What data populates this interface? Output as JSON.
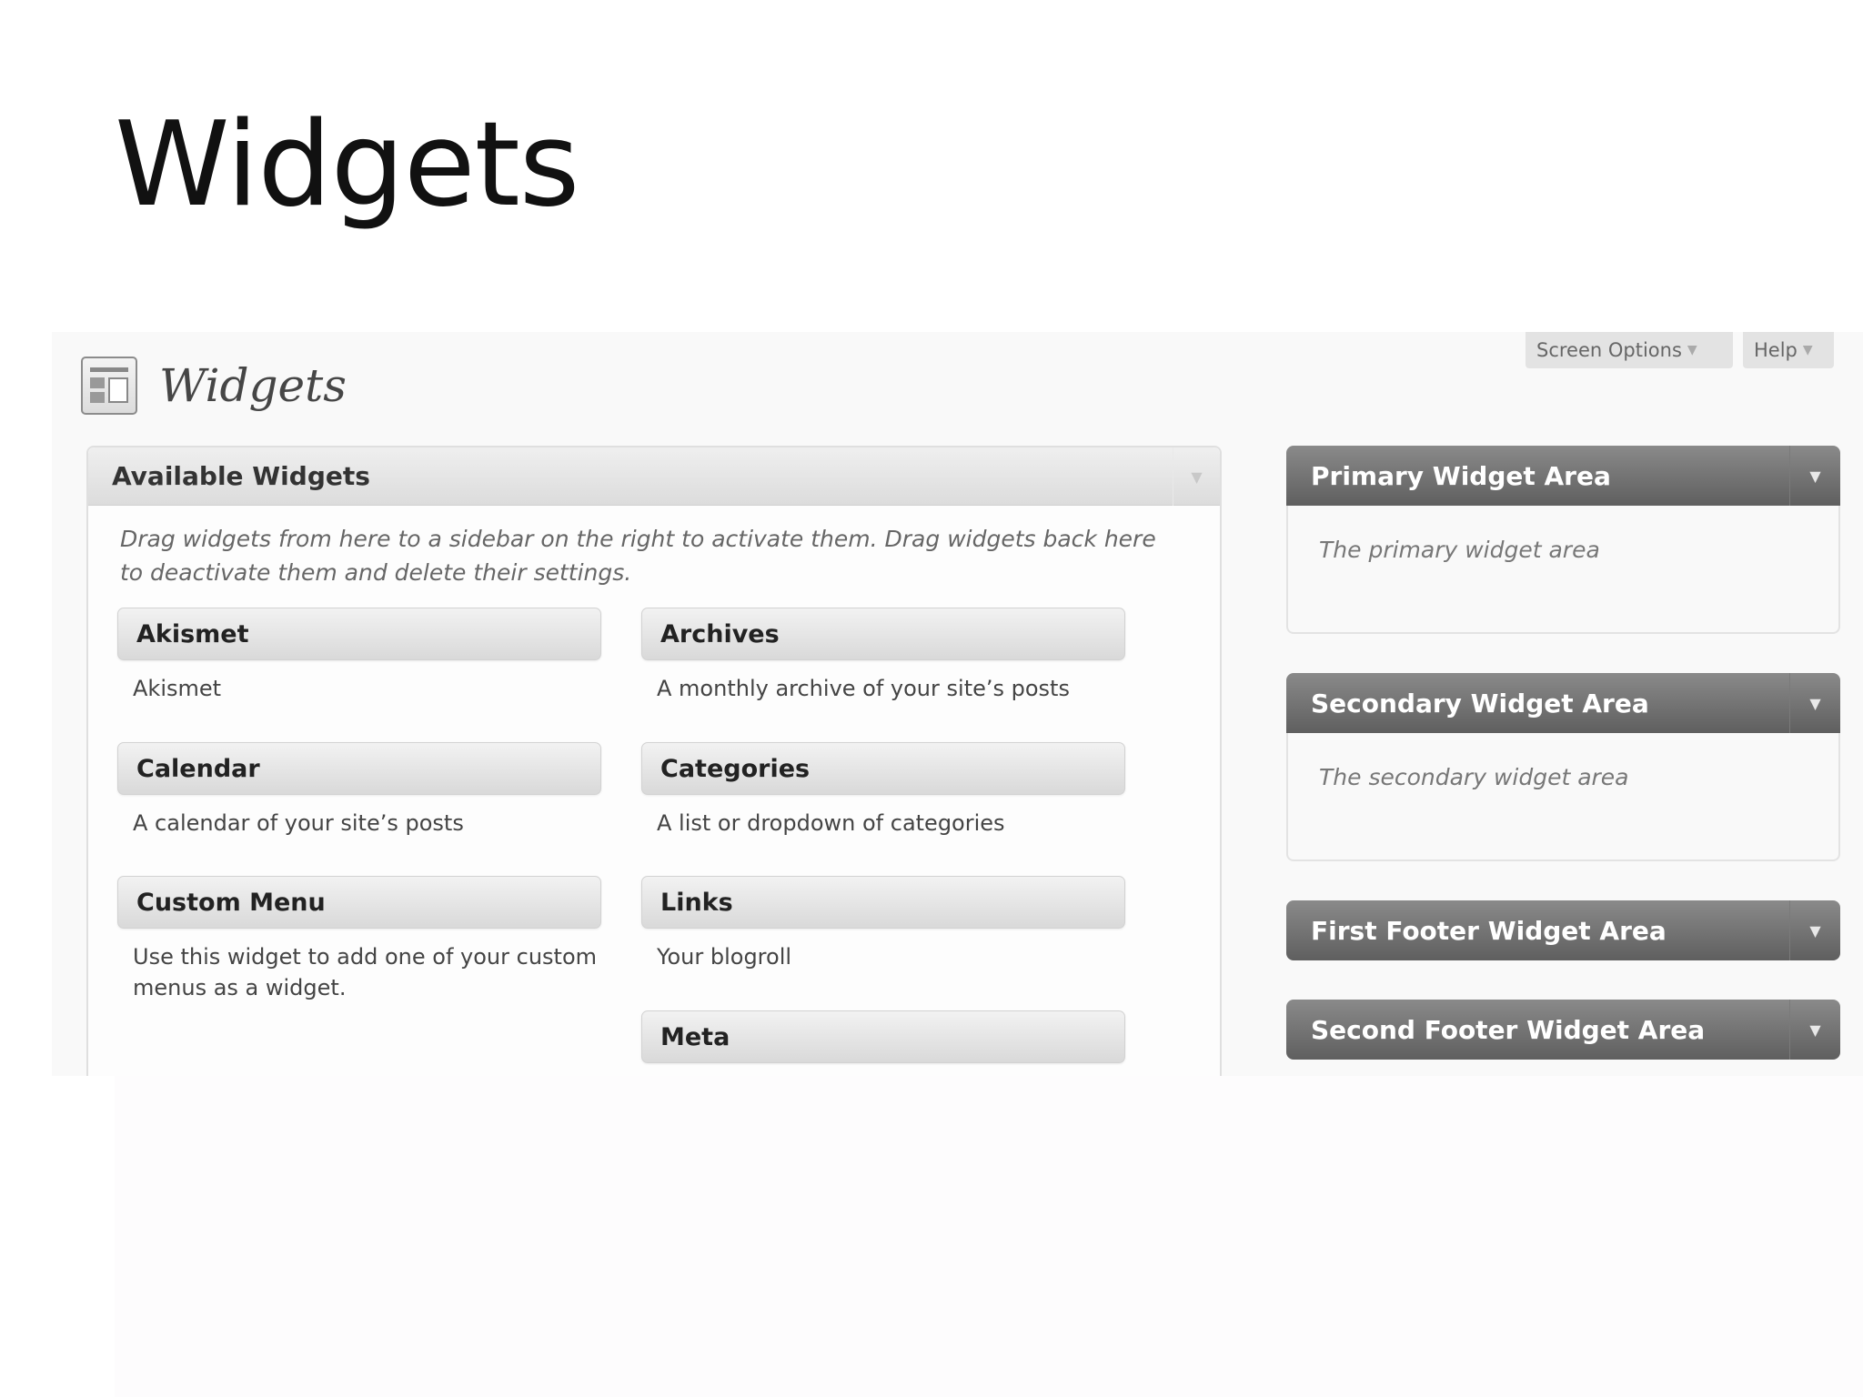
{
  "slide": {
    "title": "Widgets"
  },
  "header": {
    "screen_options_label": "Screen Options",
    "help_label": "Help",
    "page_title": "Widgets"
  },
  "available": {
    "title": "Available Widgets",
    "description": "Drag widgets from here to a sidebar on the right to activate them. Drag widgets back here to deactivate them and delete their settings.",
    "widgets": [
      {
        "name": "Akismet",
        "description": "Akismet"
      },
      {
        "name": "Archives",
        "description": "A monthly archive of your site’s posts"
      },
      {
        "name": "Calendar",
        "description": "A calendar of your site’s posts"
      },
      {
        "name": "Categories",
        "description": "A list or dropdown of categories"
      },
      {
        "name": "Custom Menu",
        "description": "Use this widget to add one of your custom menus as a widget."
      },
      {
        "name": "Links",
        "description": "Your blogroll"
      },
      {
        "name": "Meta",
        "description": ""
      }
    ]
  },
  "sidebars": [
    {
      "title": "Primary Widget Area",
      "description": "The primary widget area"
    },
    {
      "title": "Secondary Widget Area",
      "description": "The secondary widget area"
    },
    {
      "title": "First Footer Widget Area"
    },
    {
      "title": "Second Footer Widget Area"
    }
  ],
  "icons": {
    "dropdown": "triangle-down-icon",
    "page": "widgets-page-icon"
  },
  "colors": {
    "sidebar_header": "#6f6f6f",
    "widget_header": "#e4e4e4",
    "background": "#f9f9f9"
  }
}
